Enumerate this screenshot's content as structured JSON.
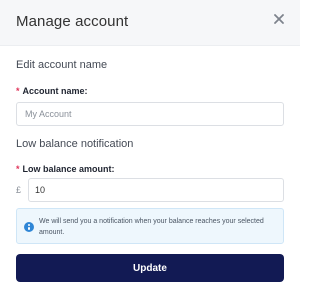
{
  "modal": {
    "title": "Manage account",
    "close_icon": "close-icon"
  },
  "account_section": {
    "heading": "Edit account name",
    "field_label": "Account name",
    "required_mark": "*",
    "colon": ":",
    "placeholder": "My Account",
    "value": ""
  },
  "balance_section": {
    "heading": "Low balance notification",
    "field_label": "Low balance amount",
    "required_mark": "*",
    "colon": ":",
    "currency_symbol": "£",
    "value": "10"
  },
  "info": {
    "icon": "info-icon",
    "text": "We will send you a notification when your balance reaches your selected amount."
  },
  "actions": {
    "update_label": "Update"
  },
  "colors": {
    "primary_button": "#121a54",
    "required": "#e0345a",
    "info_bg": "#eef7fd",
    "info_icon": "#2f86d6"
  }
}
